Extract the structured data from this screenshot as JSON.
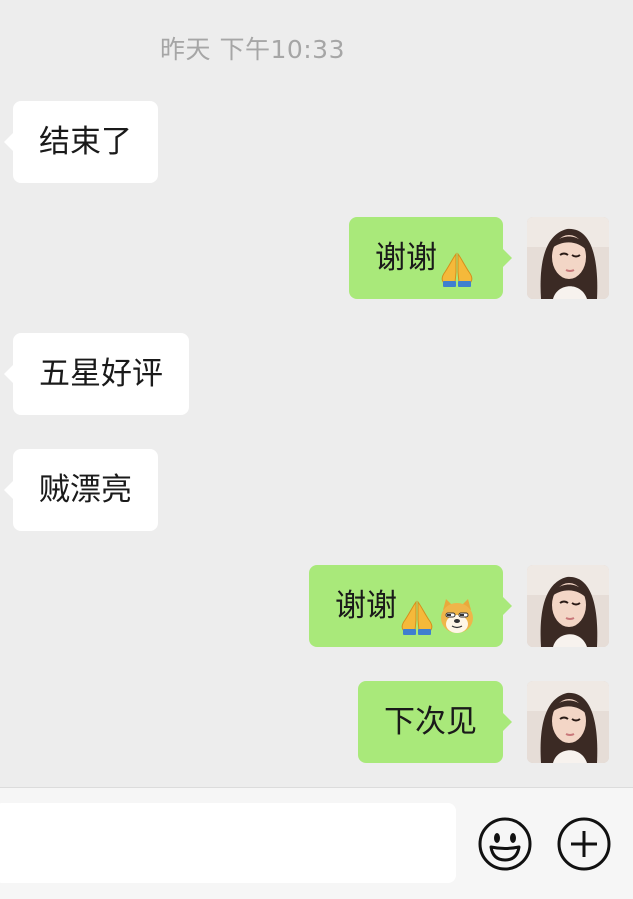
{
  "timestamp": "昨天 下午10:33",
  "messages": [
    {
      "side": "left",
      "text": "结束了"
    },
    {
      "side": "right",
      "text": "谢谢",
      "emojis": [
        "folded-hands"
      ]
    },
    {
      "side": "left",
      "text": "五星好评"
    },
    {
      "side": "left",
      "text": "贼漂亮"
    },
    {
      "side": "right",
      "text": "谢谢",
      "emojis": [
        "folded-hands",
        "doge"
      ]
    },
    {
      "side": "right",
      "text": "下次见"
    }
  ],
  "input": {
    "value": "",
    "placeholder": ""
  },
  "icons": {
    "emoji_button": "smiley-face-icon",
    "more_button": "plus-circle-icon"
  },
  "colors": {
    "background": "#ededed",
    "own_bubble": "#a9e97a",
    "other_bubble": "#ffffff",
    "timestamp": "#a6a6a6"
  }
}
